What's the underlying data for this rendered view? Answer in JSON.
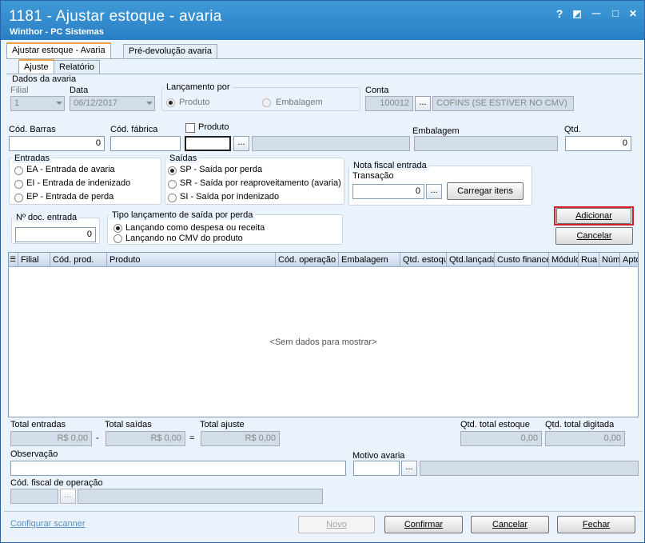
{
  "window": {
    "title": "1181 - Ajustar estoque - avaria",
    "subtitle": "Winthor - PC Sistemas",
    "help": "?",
    "restore": "◩",
    "minimize": "—",
    "maximize": "□",
    "close": "✕"
  },
  "tabs": {
    "main": [
      "Ajustar estoque - Avaria",
      "Pré-devolução avaria"
    ],
    "sub": [
      "Ajuste",
      "Relatório"
    ]
  },
  "dados": {
    "group": "Dados da avaria",
    "filial_label": "Filial",
    "filial_value": "1",
    "data_label": "Data",
    "data_value": "06/12/2017",
    "lancamento_label": "Lançamento por",
    "produto": "Produto",
    "embalagem": "Embalagem",
    "conta_label": "Conta",
    "conta_code": "100012",
    "conta_desc": "COFINS (SE ESTIVER NO CMV)"
  },
  "produto": {
    "cod_barras_label": "Cód. Barras",
    "cod_barras_value": "0",
    "cod_fabrica_label": "Cód. fábrica",
    "produto_label": "Produto",
    "embalagem_label": "Embalagem",
    "qtd_label": "Qtd.",
    "qtd_value": "0",
    "ellipsis": "..."
  },
  "entradas": {
    "title": "Entradas",
    "items": [
      "EA - Entrada de avaria",
      "EI - Entrada de indenizado",
      "EP - Entrada de perda"
    ]
  },
  "saidas": {
    "title": "Saídas",
    "items": [
      "SP - Saída por perda",
      "SR - Saída por reaproveitamento (avaria)",
      "SI - Saída por indenizado"
    ]
  },
  "nf": {
    "title": "Nota fiscal entrada",
    "transacao_label": "Transação",
    "transacao_value": "0",
    "carregar": "Carregar itens"
  },
  "ndoc": {
    "title": "Nº doc. entrada",
    "value": "0"
  },
  "tipo": {
    "title": "Tipo lançamento de saída por perda",
    "items": [
      "Lançando como despesa ou receita",
      "Lançando no CMV do produto"
    ]
  },
  "actions": {
    "adicionar": "Adicionar",
    "cancelar": "Cancelar"
  },
  "grid": {
    "columns": [
      "Filial",
      "Cód. prod.",
      "Produto",
      "Cód. operação",
      "Embalagem",
      "Qtd. estoque",
      "Qtd.lançada",
      "Custo financeiro",
      "Módulo",
      "Rua",
      "Núm",
      "Apto"
    ],
    "empty": "<Sem dados para mostrar>"
  },
  "totais": {
    "entradas_label": "Total entradas",
    "entradas_value": "R$ 0,00",
    "minus": "-",
    "saidas_label": "Total saídas",
    "saidas_value": "R$ 0,00",
    "equals": "=",
    "ajuste_label": "Total ajuste",
    "ajuste_value": "R$ 0,00",
    "qtd_estoque_label": "Qtd. total estoque",
    "qtd_estoque_value": "0,00",
    "qtd_digitada_label": "Qtd. total digitada",
    "qtd_digitada_value": "0,00"
  },
  "obs": {
    "observacao_label": "Observação",
    "motivo_label": "Motivo avaria",
    "cfop_label": "Cód. fiscal de operação"
  },
  "footer": {
    "scanner": "Configurar scanner",
    "novo": "Novo",
    "confirmar": "Confirmar",
    "cancelar": "Cancelar",
    "fechar": "Fechar"
  }
}
